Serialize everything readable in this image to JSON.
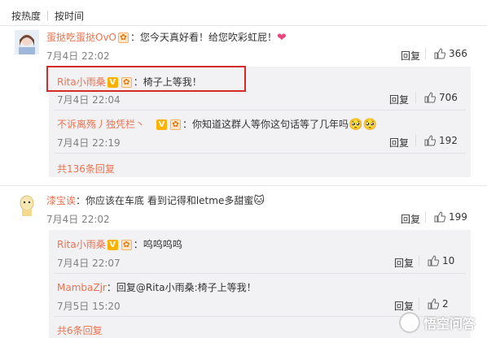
{
  "tabs": {
    "hot": "按热度",
    "time": "按时间"
  },
  "comments": [
    {
      "user": "蛋挞吃蛋挞OvO",
      "text": "：您今天真好看！给您吹彩虹屁！",
      "time": "7月4日 22:02",
      "reply": "回复",
      "likes": "366",
      "replies": [
        {
          "user": "Rita小雨桑",
          "text": "：椅子上等我！",
          "time": "7月4日 22:04",
          "reply": "回复",
          "likes": "706"
        },
        {
          "user": "不诉离殇丿独凭栏丶",
          "text": "：你知道这群人等你这句话等了几年吗",
          "time": "7月4日 22:19",
          "reply": "回复",
          "likes": "192"
        }
      ],
      "more": "共136条回复"
    },
    {
      "user": "漆宝诶",
      "text": "：你应该在车底 看到记得和letme多甜蜜",
      "time": "7月4日 22:02",
      "reply": "回复",
      "likes": "199",
      "replies": [
        {
          "user": "Rita小雨桑",
          "text": "：呜呜呜呜",
          "time": "7月4日 22:07",
          "reply": "回复",
          "likes": "10"
        },
        {
          "user": "MambaZjr",
          "text": "：回复@Rita小雨桑:椅子上等我！",
          "time": "7月5日 15:20",
          "reply": "回复",
          "likes": "2"
        }
      ],
      "more": "共6条回复"
    }
  ],
  "watermark": "悟空问答",
  "colors": {
    "name": "#eb7350",
    "highlight": "#d62a2a",
    "panel": "#f2f2f5"
  }
}
